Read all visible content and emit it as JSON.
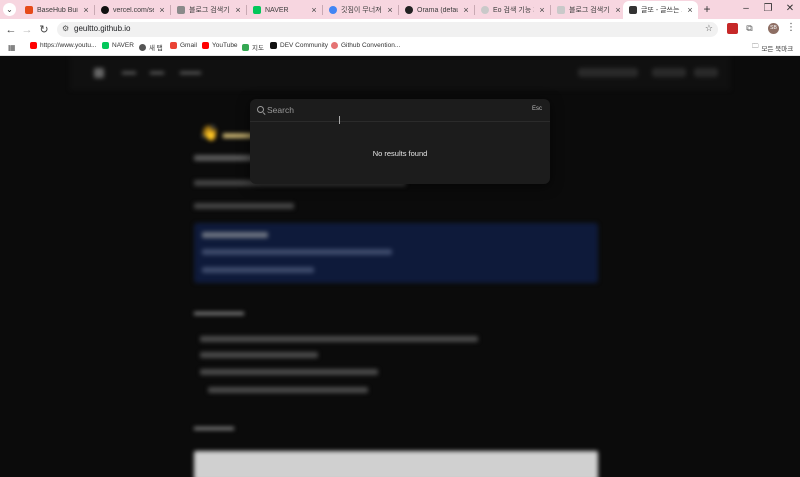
{
  "browser": {
    "tabs": [
      {
        "title": "BaseHub Build",
        "favicon_color": "#e64a19"
      },
      {
        "title": "vercel.com/seo",
        "favicon_color": "#111111"
      },
      {
        "title": "블로그 검색기능",
        "favicon_color": "#8a8a8a"
      },
      {
        "title": "NAVER",
        "favicon_color": "#03c75a"
      },
      {
        "title": "깃짐이 무너져서",
        "favicon_color": "#4285f4"
      },
      {
        "title": "Orama (default)",
        "favicon_color": "#222222"
      },
      {
        "title": "Eo 검색 기능 개",
        "favicon_color": "#c9c9c9"
      },
      {
        "title": "블로그 검색기능",
        "favicon_color": "#c9c9c9"
      },
      {
        "title": "글또 - 글쓰는 또",
        "favicon_color": "#333333",
        "active": true
      }
    ],
    "url": "geultto.github.io",
    "bookmarks": [
      {
        "label": "https://www.youtu...",
        "icon_color": "#ff0000"
      },
      {
        "label": "NAVER",
        "icon_color": "#03c75a"
      },
      {
        "label": "새 탭",
        "icon_color": "#555555"
      },
      {
        "label": "Gmail",
        "icon_color": "#ea4335"
      },
      {
        "label": "YouTube",
        "icon_color": "#ff0000"
      },
      {
        "label": "지도",
        "icon_color": "#34a853"
      },
      {
        "label": "DEV Community",
        "icon_color": "#111111"
      },
      {
        "label": "Github Convention...",
        "icon_color": "#e57373"
      }
    ],
    "all_bookmarks_label": "모든 북마크",
    "avatar_initials": "SB"
  },
  "search_modal": {
    "placeholder": "Search",
    "esc_label": "Esc",
    "empty_message": "No results found"
  }
}
